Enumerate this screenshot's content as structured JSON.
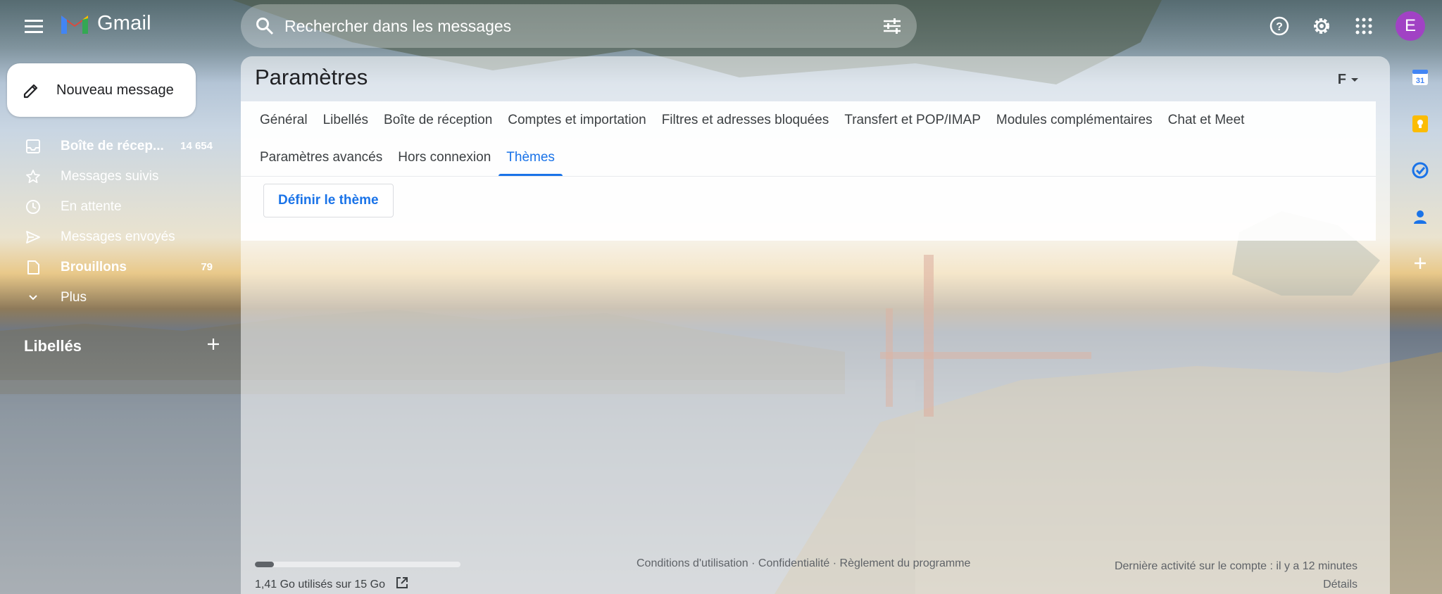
{
  "app": {
    "name": "Gmail"
  },
  "search": {
    "placeholder": "Rechercher dans les messages"
  },
  "account": {
    "avatar_letter": "E",
    "avatar_color": "#a142c4"
  },
  "compose": {
    "label": "Nouveau message"
  },
  "nav": {
    "items": [
      {
        "label": "Boîte de récep...",
        "count": "14 654",
        "icon": "inbox-icon",
        "bold": true
      },
      {
        "label": "Messages suivis",
        "count": "",
        "icon": "star-icon",
        "bold": false
      },
      {
        "label": "En attente",
        "count": "",
        "icon": "clock-icon",
        "bold": false
      },
      {
        "label": "Messages envoyés",
        "count": "",
        "icon": "send-icon",
        "bold": false
      },
      {
        "label": "Brouillons",
        "count": "79",
        "icon": "draft-icon",
        "bold": true
      },
      {
        "label": "Plus",
        "count": "",
        "icon": "chevron-down-icon",
        "bold": false
      }
    ],
    "labels_heading": "Libellés"
  },
  "settings": {
    "title": "Paramètres",
    "lang_label": "F",
    "tabs_row1": [
      "Général",
      "Libellés",
      "Boîte de réception",
      "Comptes et importation",
      "Filtres et adresses bloquées",
      "Transfert et POP/IMAP",
      "Modules complémentaires",
      "Chat et Meet"
    ],
    "tabs_row2": [
      "Paramètres avancés",
      "Hors connexion",
      "Thèmes"
    ],
    "active_tab": "Thèmes",
    "theme_button": "Définir le thème"
  },
  "footer": {
    "storage_text": "1,41 Go utilisés sur 15 Go",
    "storage_used_fraction": 0.094,
    "links": "Conditions d'utilisation · Confidentialité · Règlement du programme",
    "activity": "Dernière activité sur le compte : il y a 12 minutes",
    "details": "Détails"
  },
  "colors": {
    "accent": "#1a73e8",
    "text": "#202124"
  }
}
